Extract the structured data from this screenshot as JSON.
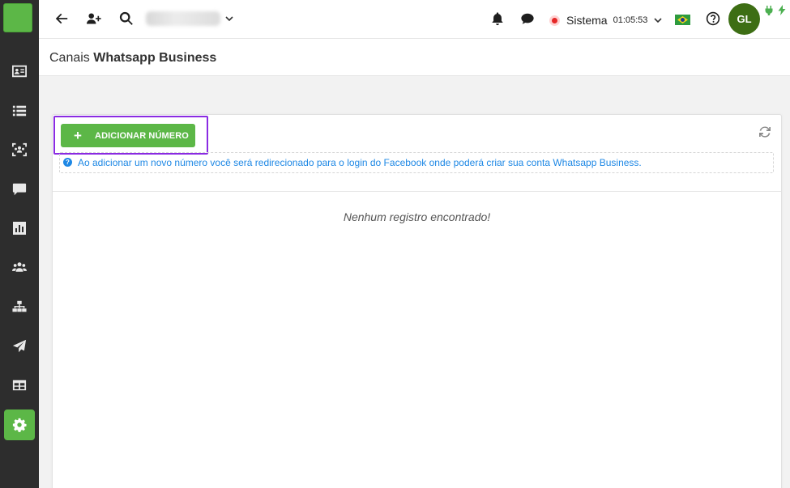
{
  "sidebar": {
    "items": [
      {
        "name": "id-card-icon"
      },
      {
        "name": "list-icon"
      },
      {
        "name": "users-frame-icon"
      },
      {
        "name": "chat-icon"
      },
      {
        "name": "chart-icon"
      },
      {
        "name": "group-icon"
      },
      {
        "name": "network-icon"
      },
      {
        "name": "send-icon"
      },
      {
        "name": "table-icon"
      },
      {
        "name": "gear-icon",
        "active": true
      }
    ],
    "accent": "#5cb747"
  },
  "topbar": {
    "status_label": "Sistema",
    "status_time": "01:05:53",
    "status_color": "#e52727",
    "avatar_initials": "GL",
    "avatar_color": "#3d6e14",
    "language_flag": "brazil-flag-icon"
  },
  "page": {
    "title_prefix": "Canais",
    "title_bold": "Whatsapp Business"
  },
  "card": {
    "add_button_label": "ADICIONAR NÚMERO",
    "info_text": "Ao adicionar um novo número você será redirecionado para o login do Facebook onde poderá criar sua conta Whatsapp Business.",
    "empty_text": "Nenhum registro encontrado!",
    "info_color": "#1e88e5"
  }
}
